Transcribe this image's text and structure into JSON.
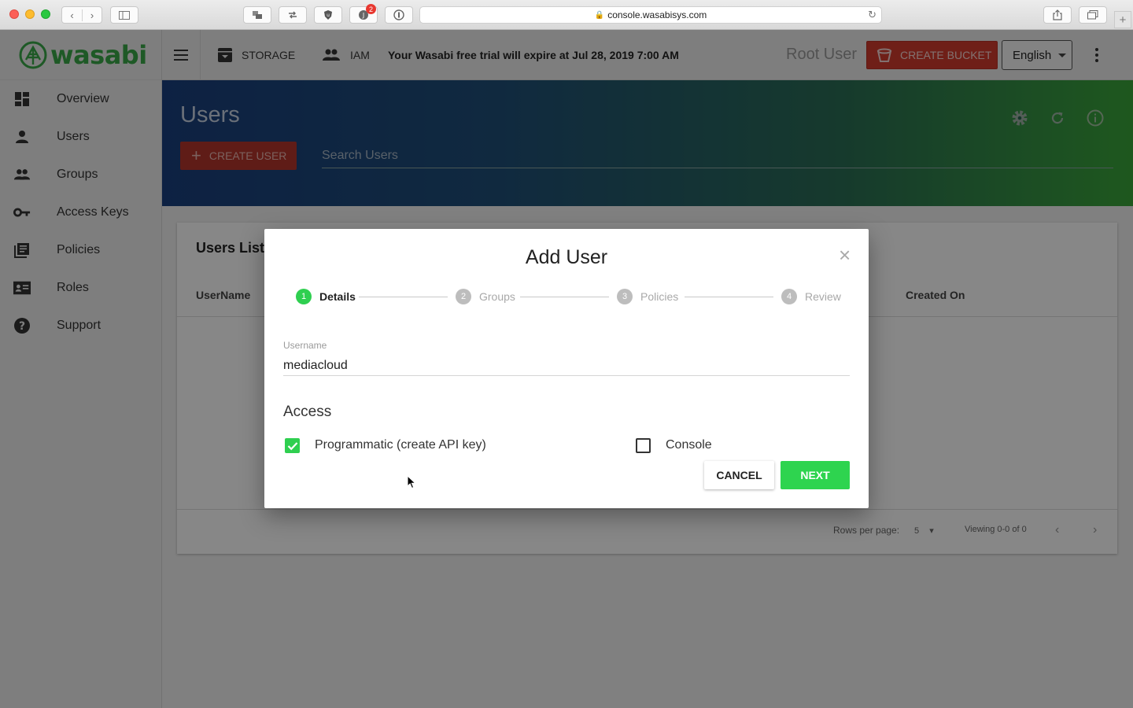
{
  "browser": {
    "url": "console.wasabisys.com",
    "extension_badge": "2"
  },
  "logo": {
    "text": "wasabi"
  },
  "sidebar": {
    "items": [
      {
        "label": "Overview",
        "icon": "dashboard-icon"
      },
      {
        "label": "Users",
        "icon": "person-icon"
      },
      {
        "label": "Groups",
        "icon": "group-icon"
      },
      {
        "label": "Access Keys",
        "icon": "key-icon"
      },
      {
        "label": "Policies",
        "icon": "library-books-icon"
      },
      {
        "label": "Roles",
        "icon": "id-card-icon"
      },
      {
        "label": "Support",
        "icon": "help-circle-icon"
      }
    ]
  },
  "topbar": {
    "storage_label": "STORAGE",
    "iam_label": "IAM",
    "trial_notice": "Your Wasabi free trial will expire at Jul 28, 2019 7:00 AM",
    "user_label": "Root User",
    "create_bucket_label": "CREATE BUCKET",
    "language": "English"
  },
  "hero": {
    "title": "Users",
    "create_user_label": "CREATE USER",
    "search_placeholder": "Search Users"
  },
  "users_list": {
    "title": "Users List",
    "columns": [
      "UserName",
      "Created On"
    ],
    "rows_per_page_label": "Rows per page:",
    "rows_per_page_value": "5",
    "viewing_label": "Viewing 0-0 of 0"
  },
  "modal": {
    "title": "Add User",
    "steps": [
      {
        "number": "1",
        "label": "Details",
        "active": true
      },
      {
        "number": "2",
        "label": "Groups",
        "active": false
      },
      {
        "number": "3",
        "label": "Policies",
        "active": false
      },
      {
        "number": "4",
        "label": "Review",
        "active": false
      }
    ],
    "username_label": "Username",
    "username_value": "mediacloud",
    "access_heading": "Access",
    "programmatic_label": "Programmatic (create API key)",
    "programmatic_checked": true,
    "console_label": "Console",
    "console_checked": false,
    "cancel_label": "CANCEL",
    "next_label": "NEXT"
  },
  "colors": {
    "brand_green": "#3aa848",
    "accent_red": "#d13c2f",
    "step_active": "#2fcf50",
    "next_button": "#2ed44f"
  }
}
